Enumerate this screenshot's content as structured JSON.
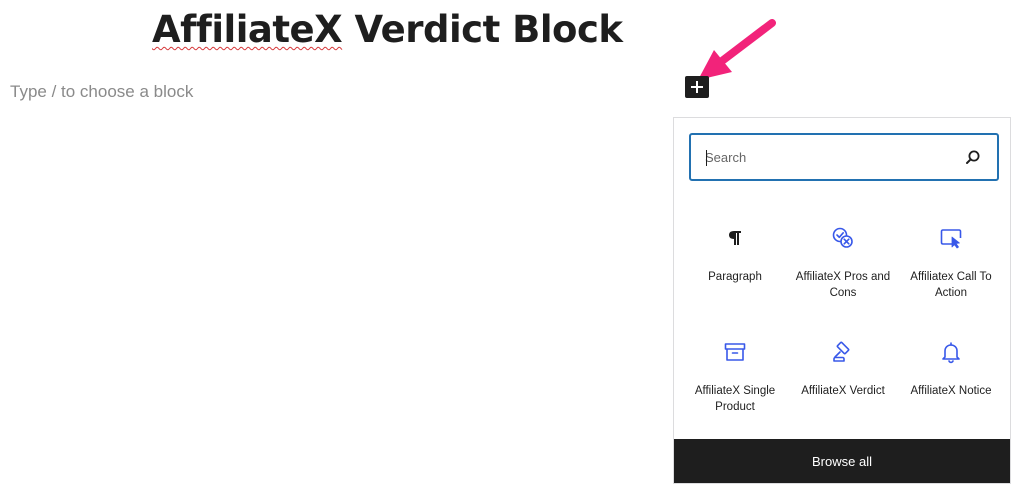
{
  "editor": {
    "title_part1": "AffiliateX",
    "title_part2": " Verdict Block",
    "placeholder": "Type / to choose a block"
  },
  "inserter": {
    "toggle_icon": "plus-icon",
    "search_placeholder": "Search",
    "blocks": [
      {
        "label": "Paragraph",
        "icon": "paragraph-icon"
      },
      {
        "label": "AffiliateX Pros and Cons",
        "icon": "pros-cons-icon"
      },
      {
        "label": "Affiliatex Call To Action",
        "icon": "call-to-action-icon"
      },
      {
        "label": "AffiliateX Single Product",
        "icon": "single-product-icon"
      },
      {
        "label": "AffiliateX Verdict",
        "icon": "verdict-gavel-icon"
      },
      {
        "label": "AffiliateX Notice",
        "icon": "notice-bell-icon"
      }
    ],
    "browse_all": "Browse all"
  },
  "colors": {
    "accent": "#2271b1",
    "icon_blue": "#3858e9",
    "annotation_arrow": "#f2237a",
    "dark": "#1e1e1e"
  }
}
